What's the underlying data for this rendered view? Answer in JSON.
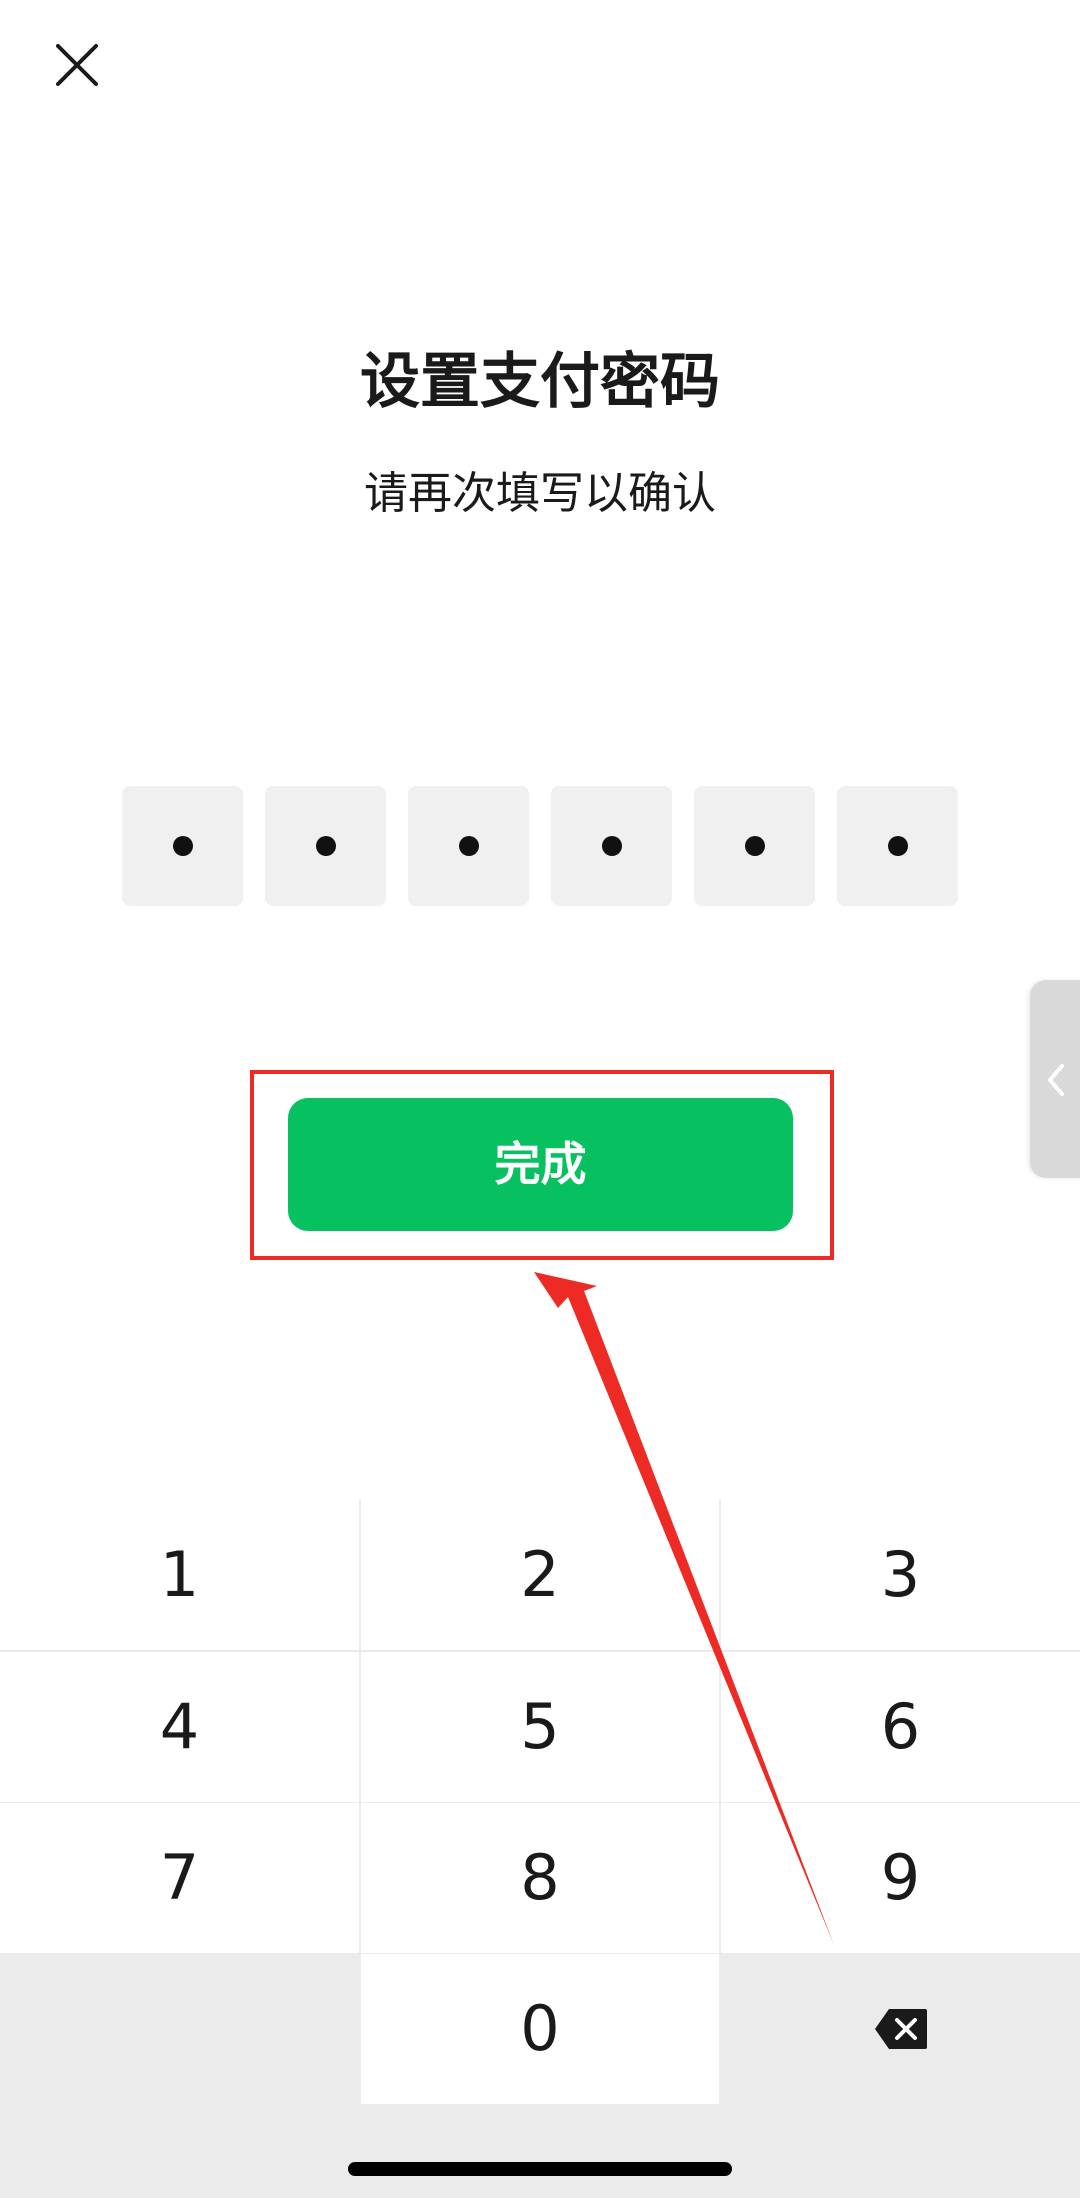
{
  "page": {
    "title": "设置支付密码",
    "subtitle": "请再次填写以确认"
  },
  "pin": {
    "length": 6,
    "filled": 6
  },
  "actions": {
    "done_label": "完成"
  },
  "keypad": {
    "keys": [
      "1",
      "2",
      "3",
      "4",
      "5",
      "6",
      "7",
      "8",
      "9",
      "0"
    ]
  },
  "icons": {
    "close": "close-icon",
    "side_tab": "chevron-left-icon",
    "delete": "backspace-icon"
  },
  "colors": {
    "accent": "#07c160",
    "annotation": "#ee2a24",
    "pin_box": "#f0f0f0",
    "keypad_bg": "#ebebeb"
  }
}
